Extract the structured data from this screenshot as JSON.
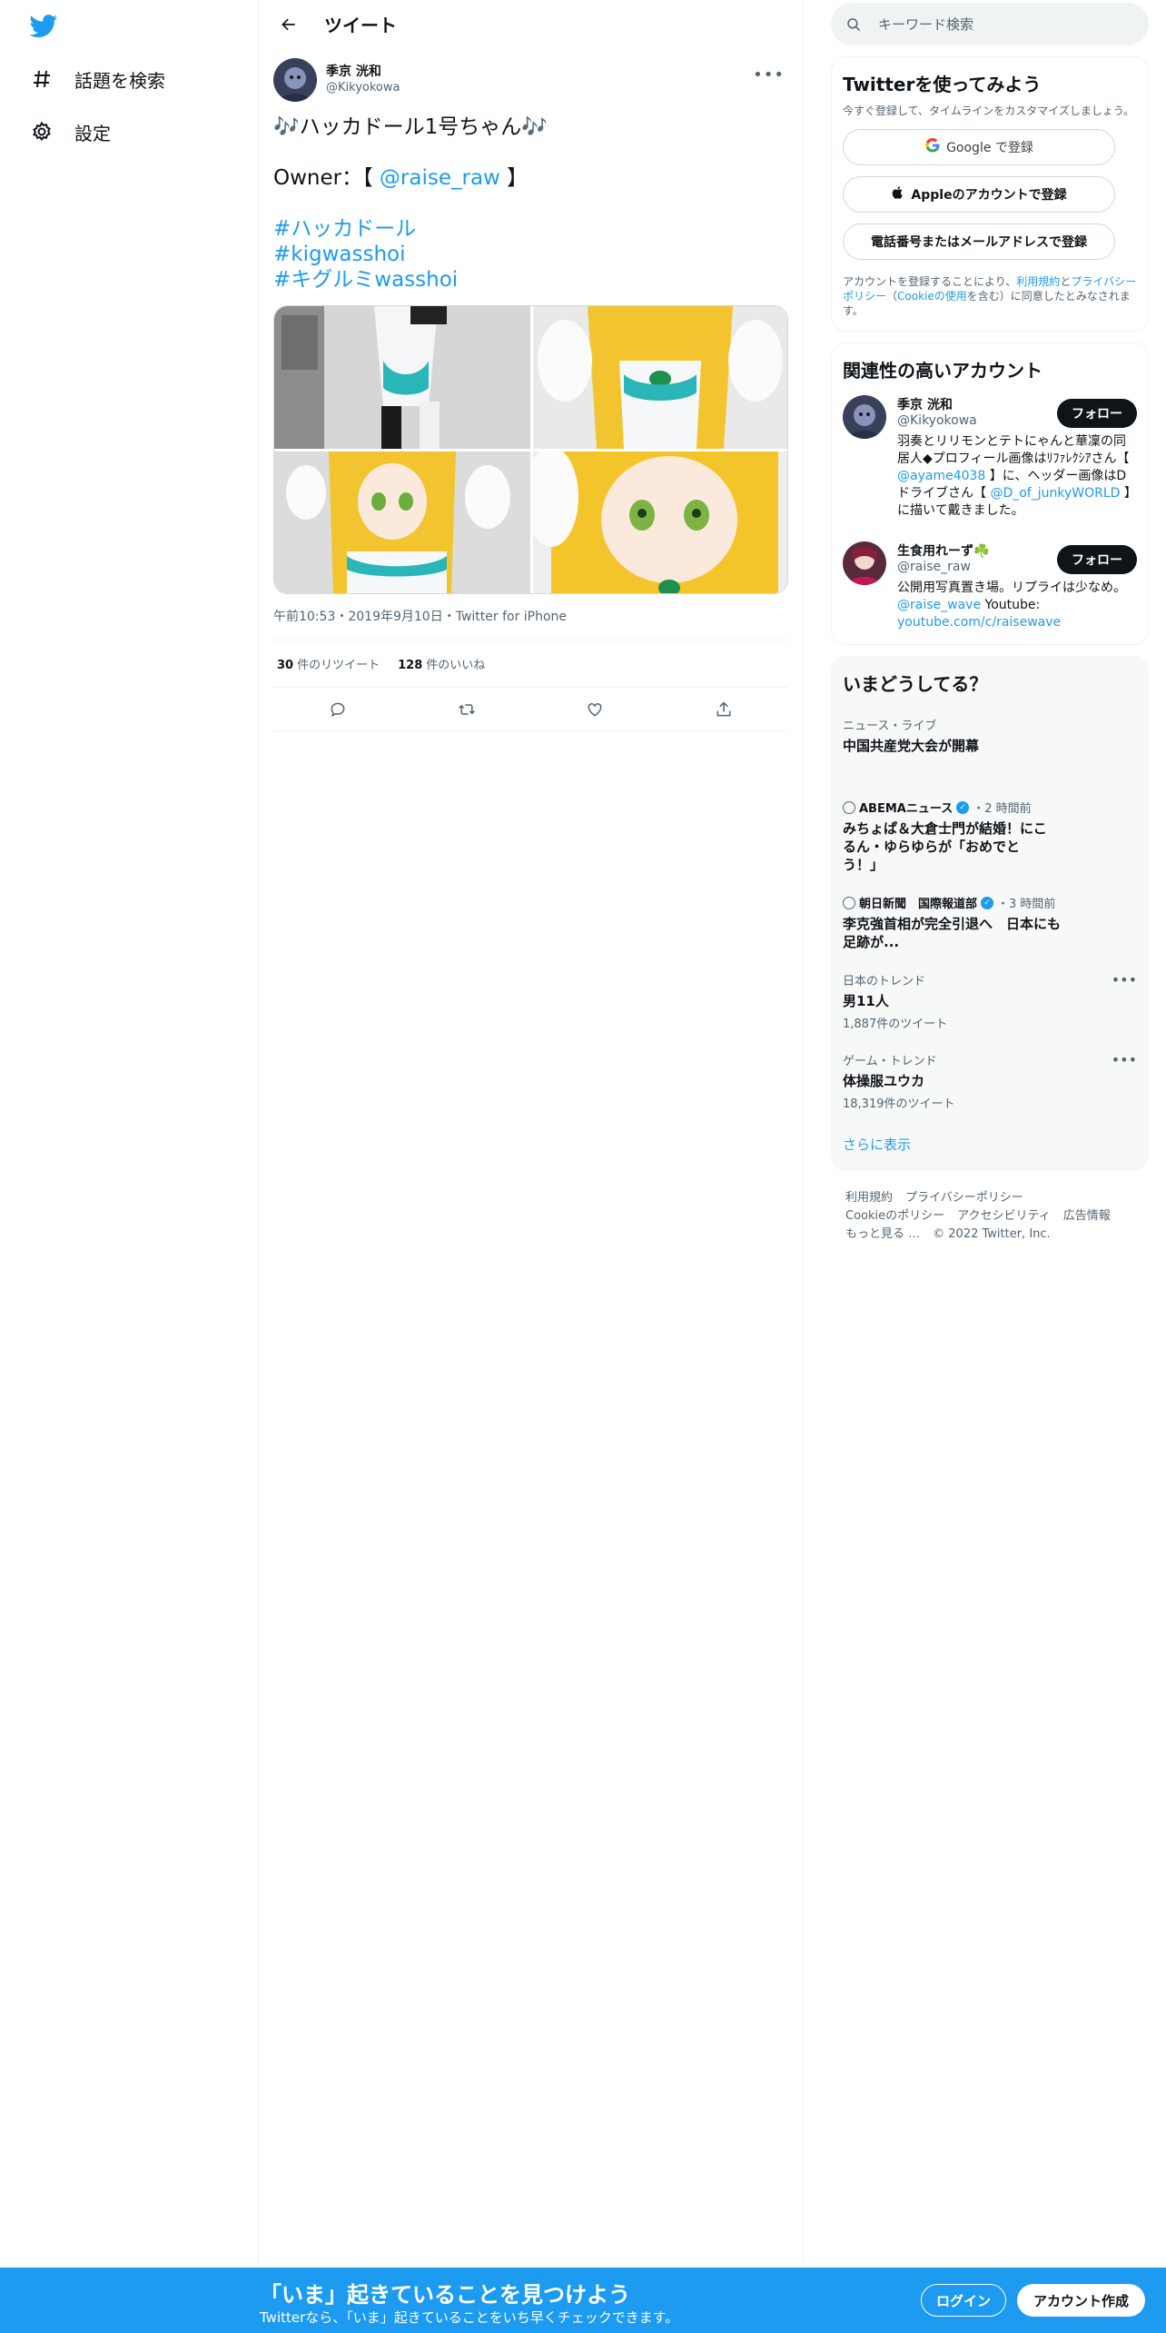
{
  "nav": {
    "logo": "twitter-bird-icon",
    "items": [
      {
        "label": "話題を検索",
        "icon": "hashtag-icon"
      },
      {
        "label": "設定",
        "icon": "gear-icon"
      }
    ]
  },
  "header": {
    "title": "ツイート"
  },
  "tweet": {
    "author_name": "季京 洸和",
    "author_handle": "@Kikyokowa",
    "line1": "🎶ハッカドール1号ちゃん🎶",
    "owner_prefix": "Owner：【",
    "owner_mention": "@raise_raw",
    "owner_suffix": "】",
    "hashtags": [
      "#ハッカドール",
      "#kigwasshoi",
      "#キグルミwasshoi"
    ],
    "time": "午前10:53",
    "date": "2019年9月10日",
    "client": "Twitter for iPhone",
    "retweet_count": "30",
    "retweet_label": "件のリツイート",
    "like_count": "128",
    "like_label": "件のいいね"
  },
  "search": {
    "placeholder": "キーワード検索"
  },
  "signup_card": {
    "title": "Twitterを使ってみよう",
    "subtitle": "今すぐ登録して、タイムラインをカスタマイズしましょう。",
    "google": "Google で登録",
    "apple": "Appleのアカウントで登録",
    "phone": "電話番号またはメールアドレスで登録",
    "legal_pre": "アカウントを登録することにより、",
    "legal_terms": "利用規約",
    "legal_and": "と",
    "legal_privacy": "プライバシーポリシー",
    "legal_paren_open": "（",
    "legal_cookie": "Cookieの使用",
    "legal_post": "を含む）に同意したとみなされます。"
  },
  "related": {
    "title": "関連性の高いアカウント",
    "accounts": [
      {
        "name": "季京 洸和",
        "handle": "@Kikyokowa",
        "follow": "フォロー",
        "bio_1": "羽奏とリリモンとテトにゃんと華凜の同居人◆プロフィール画像はﾘﾌｧﾚｸｼｱさん【 ",
        "bio_link1": "@ayame4038",
        "bio_2": " 】に、ヘッダー画像はDドライブさん【 ",
        "bio_link2": "@D_of_junkyWORLD",
        "bio_3": " 】に描いて戴きました。"
      },
      {
        "name": "生食用れーず☘️",
        "handle": "@raise_raw",
        "follow": "フォロー",
        "bio_1": "公開用写真置き場。リプライは少なめ。 ",
        "bio_link1": "@raise_wave",
        "bio_2": " Youtube: ",
        "bio_link2": "youtube.com/c/raisewave"
      }
    ]
  },
  "trends": {
    "title": "いまどうしてる？",
    "items": [
      {
        "context": "ニュース・ライブ",
        "title": "中国共産党大会が開幕"
      },
      {
        "source": "ABEMAニュース",
        "time": "・2 時間前",
        "title": "みちょぱ＆大倉士門が結婚！にこるん・ゆらゆらが「おめでとう！」"
      },
      {
        "source": "朝日新聞　国際報道部",
        "time": "・3 時間前",
        "title": "李克強首相が完全引退へ　日本にも足跡が..."
      },
      {
        "context": "日本のトレンド",
        "title": "男11人",
        "count": "1,887件のツイート"
      },
      {
        "context": "ゲーム・トレンド",
        "title": "体操服ユウカ",
        "count": "18,319件のツイート"
      }
    ],
    "show_more": "さらに表示"
  },
  "footer": {
    "links": [
      "利用規約",
      "プライバシーポリシー",
      "Cookieのポリシー",
      "アクセシビリティ",
      "広告情報",
      "もっと見る …"
    ],
    "copyright": "© 2022 Twitter, Inc."
  },
  "bottom_bar": {
    "title": "「いま」起きていることを見つけよう",
    "subtitle": "Twitterなら、「いま」起きていることをいち早くチェックできます。",
    "login": "ログイン",
    "signup": "アカウント作成"
  },
  "colors": {
    "accent": "#1d9bf0",
    "text": "#0f1419",
    "secondary": "#536471",
    "border": "#eff3f4"
  }
}
